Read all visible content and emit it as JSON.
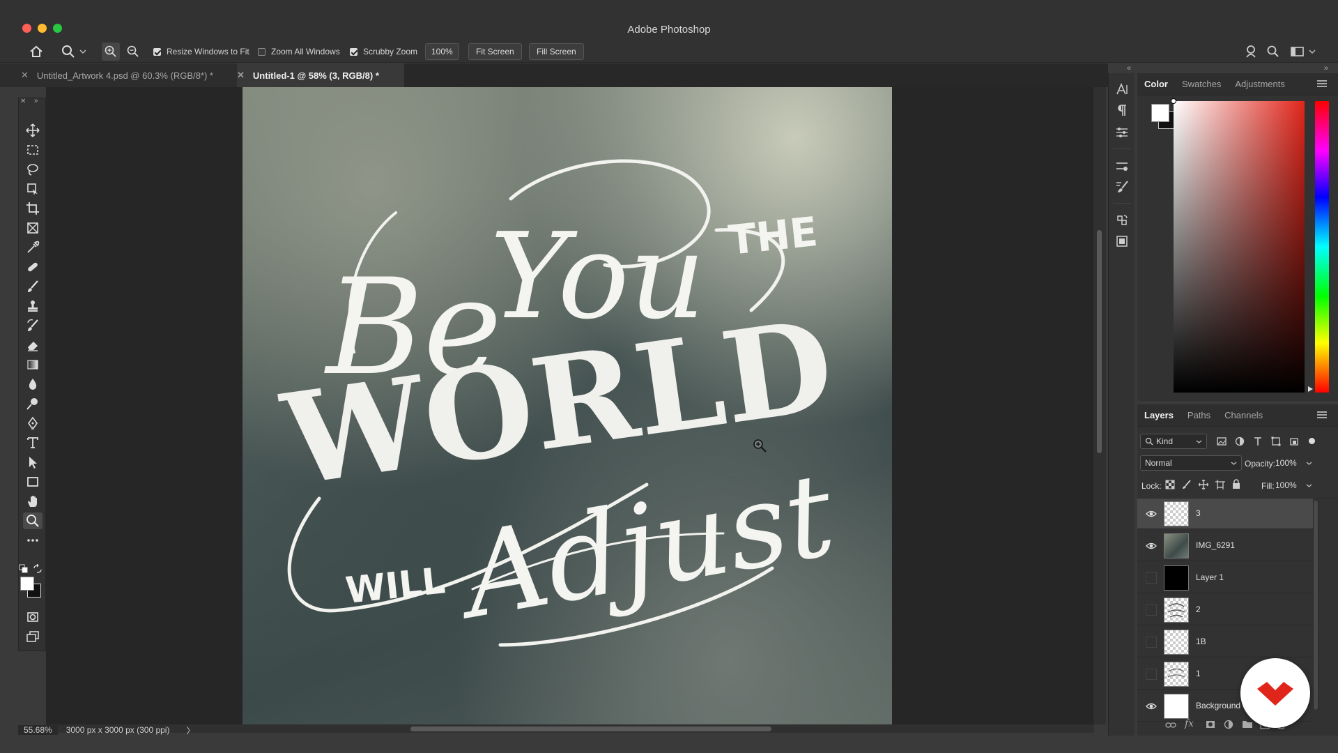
{
  "window": {
    "title": "Adobe Photoshop"
  },
  "options_bar": {
    "resize_windows": {
      "label": "Resize Windows to Fit",
      "checked": true
    },
    "zoom_all_windows": {
      "label": "Zoom All Windows",
      "checked": false
    },
    "scrubby_zoom": {
      "label": "Scrubby Zoom",
      "checked": true
    },
    "zoom_value": "100%",
    "fit_screen": "Fit Screen",
    "fill_screen": "Fill Screen"
  },
  "tabs": [
    {
      "label": "Untitled_Artwork 4.psd @ 60.3% (RGB/8*) *",
      "active": false
    },
    {
      "label": "Untitled-1 @ 58% (3, RGB/8) *",
      "active": true
    }
  ],
  "status": {
    "zoom": "55.68%",
    "doc_info": "3000 px x 3000 px (300 ppi)",
    "arrow": "〉"
  },
  "artwork": {
    "line1": "Be",
    "line1b": "You",
    "line1c": "THE",
    "line2": "WORLD",
    "line3a": "WILL",
    "line3b": "Adjust"
  },
  "color_panel": {
    "tabs": [
      "Color",
      "Swatches",
      "Adjustments"
    ],
    "active": "Color"
  },
  "layers_panel": {
    "tabs": [
      "Layers",
      "Paths",
      "Channels"
    ],
    "active": "Layers",
    "filter_label": "Kind",
    "blend_mode": "Normal",
    "opacity_label": "Opacity:",
    "opacity_value": "100%",
    "lock_label": "Lock:",
    "fill_label": "Fill:",
    "fill_value": "100%",
    "layers": [
      {
        "name": "3",
        "visible": true,
        "selected": true,
        "thumb": "checker"
      },
      {
        "name": "IMG_6291",
        "visible": true,
        "selected": false,
        "thumb": "photo"
      },
      {
        "name": "Layer 1",
        "visible": false,
        "selected": false,
        "thumb": "black"
      },
      {
        "name": "2",
        "visible": false,
        "selected": false,
        "thumb": "sketch"
      },
      {
        "name": "1B",
        "visible": false,
        "selected": false,
        "thumb": "checker"
      },
      {
        "name": "1",
        "visible": false,
        "selected": false,
        "thumb": "sketch"
      },
      {
        "name": "Background",
        "visible": true,
        "selected": false,
        "thumb": "white"
      }
    ]
  },
  "colors": {
    "accent_red": "#e0261b",
    "panel_bg": "#323232"
  }
}
